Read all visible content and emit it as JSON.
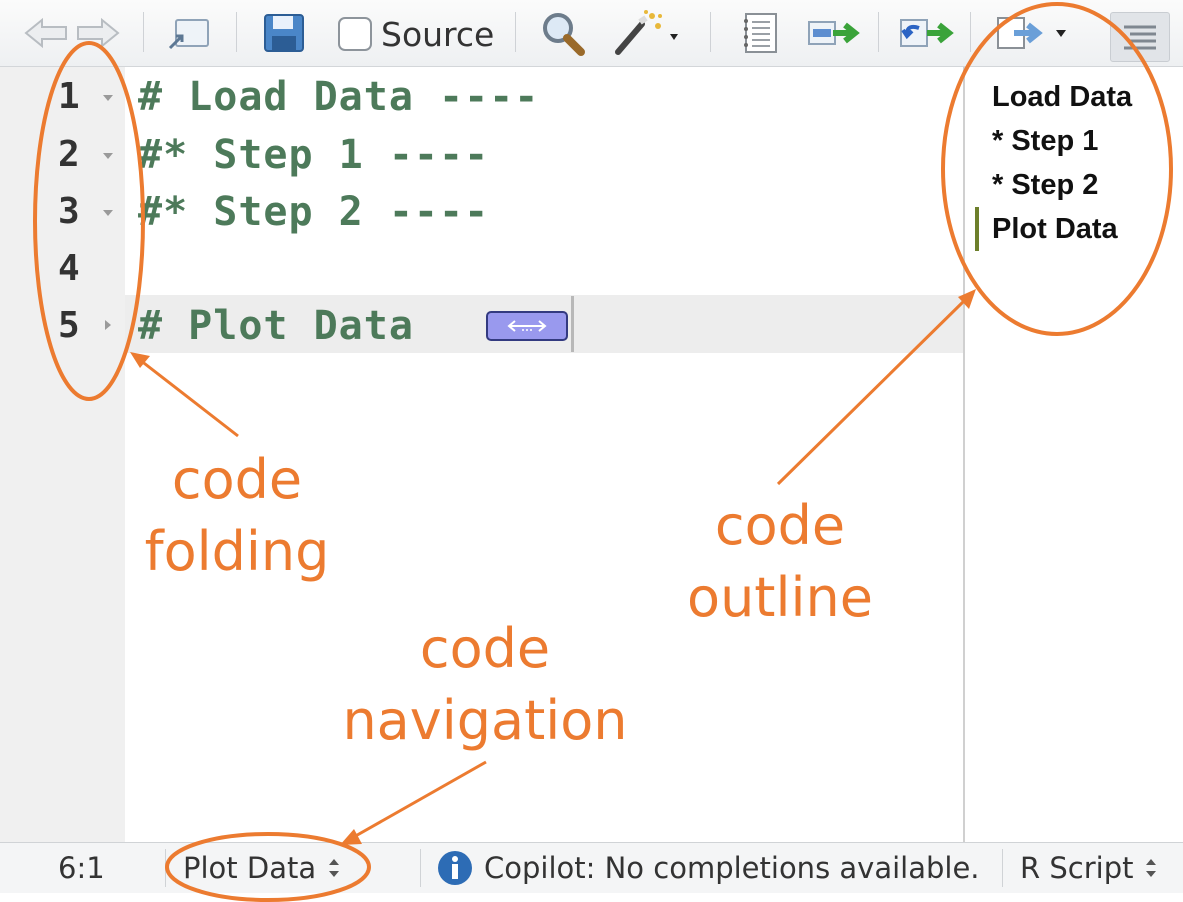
{
  "toolbar": {
    "source_label": "Source",
    "icons": [
      "back-arrow-icon",
      "forward-arrow-icon",
      "show-in-window-icon",
      "save-icon",
      "search-icon",
      "magic-wand-icon",
      "compile-notebook-icon",
      "run-lines-icon",
      "rerun-icon",
      "source-menu-icon",
      "outline-icon"
    ]
  },
  "gutter": {
    "line_numbers": [
      "1",
      "2",
      "3",
      "4",
      "5"
    ]
  },
  "editor": {
    "lines": [
      "# Load Data ----",
      "#* Step 1 ----",
      "#* Step 2 ----",
      "",
      "# Plot Data "
    ]
  },
  "outline": {
    "items": [
      "Load Data",
      "* Step 1",
      "* Step 2",
      "Plot Data"
    ]
  },
  "statusbar": {
    "position": "6:1",
    "navigation": "Plot Data",
    "copilot": "Copilot: No completions available.",
    "filetype": "R Script"
  },
  "annotations": {
    "folding_1": "code",
    "folding_2": "folding",
    "outline_1": "code",
    "outline_2": "outline",
    "navigation_1": "code",
    "navigation_2": "navigation",
    "color": "#ec7b30"
  }
}
